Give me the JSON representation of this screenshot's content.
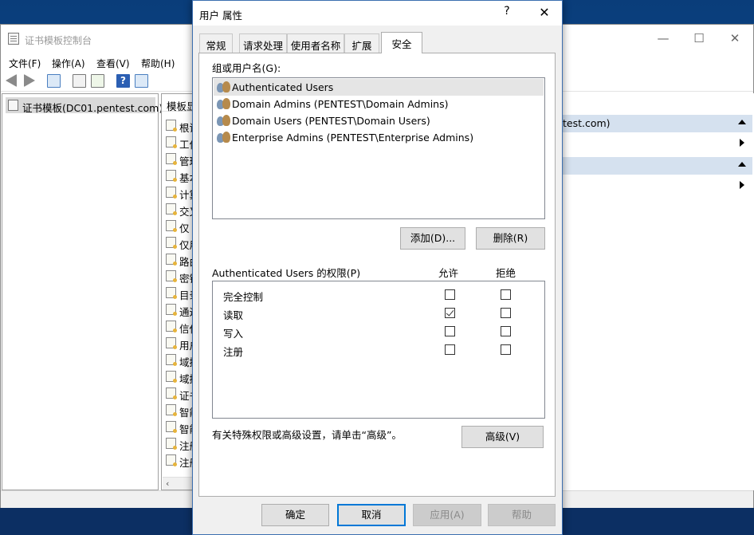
{
  "mmc": {
    "title": "证书模板控制台",
    "menu": [
      "文件(F)",
      "操作(A)",
      "查看(V)",
      "帮助(H)"
    ],
    "tree_item": "证书模板(DC01.pentest.com)",
    "list_header": "模板显示名称",
    "templates": [
      "根证",
      "工作",
      "管理",
      "基本",
      "计算",
      "交叉",
      "仅",
      "仅用",
      "路由",
      "密钥",
      "目录",
      "通过",
      "信任",
      "用户",
      "域控",
      "域控",
      "证书",
      "智能",
      "智能",
      "注册",
      "注册"
    ],
    "actions": {
      "section1": "test.com)",
      "section2": ""
    }
  },
  "dialog": {
    "title": "用户 属性",
    "help_glyph": "?",
    "close_glyph": "✕",
    "tabs": [
      "常规",
      "请求处理",
      "使用者名称",
      "扩展",
      "安全"
    ],
    "active_tab": "安全",
    "groups_label": "组或用户名(G):",
    "users": [
      "Authenticated Users",
      "Domain Admins (PENTEST\\Domain Admins)",
      "Domain Users (PENTEST\\Domain Users)",
      "Enterprise Admins (PENTEST\\Enterprise Admins)"
    ],
    "selected_user_index": 0,
    "add_button": "添加(D)...",
    "remove_button": "删除(R)",
    "perm_label": "Authenticated Users 的权限(P)",
    "allow_header": "允许",
    "deny_header": "拒绝",
    "permissions": [
      {
        "name": "完全控制",
        "allow": false,
        "deny": false
      },
      {
        "name": "读取",
        "allow": true,
        "deny": false
      },
      {
        "name": "写入",
        "allow": false,
        "deny": false
      },
      {
        "name": "注册",
        "allow": false,
        "deny": false
      }
    ],
    "advanced_hint": "有关特殊权限或高级设置，请单击“高级”。",
    "advanced_button": "高级(V)",
    "ok_button": "确定",
    "cancel_button": "取消",
    "apply_button": "应用(A)",
    "help_button": "帮助"
  }
}
